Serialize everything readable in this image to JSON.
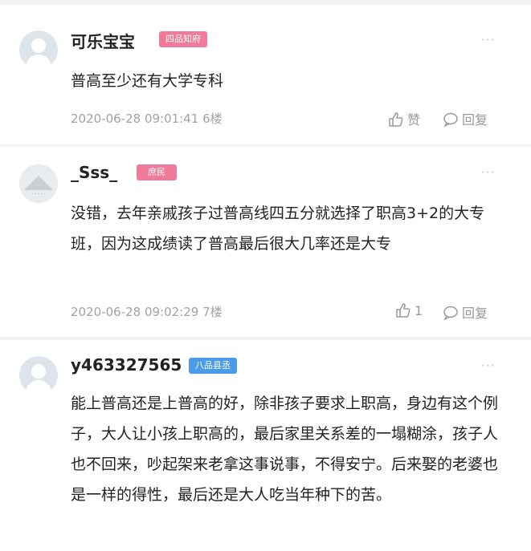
{
  "comments": [
    {
      "username": "可乐宝宝",
      "badge": "四品知府",
      "badge_color": "#f07a9a",
      "text": "普高至少还有大学专科",
      "timestamp": "2020-06-28 09:01:41",
      "floor": "6楼",
      "like_label": "赞",
      "reply_label": "回复",
      "avatar_icon": "default-user-icon"
    },
    {
      "username": "_Sss_",
      "badge": "庶民",
      "badge_color": "#f07a9a",
      "text": "没错，去年亲戚孩子过普高线四五分就选择了职高3+2的大专班，因为这成绩读了普高最后很大几率还是大专",
      "timestamp": "2020-06-28 09:02:29",
      "floor": "7楼",
      "like_count": "1",
      "reply_label": "回复",
      "avatar_icon": "landscape-avatar-icon"
    },
    {
      "username": "y463327565",
      "badge": "八品县丞",
      "badge_color": "#4a9be8",
      "text": "能上普高还是上普高的好，除非孩子要求上职高，身边有这个例子，大人让小孩上职高的，最后家里关系差的一塌糊涂，孩子人也不回来，吵起架来老拿这事说事，不得安宁。后来娶的老婆也是一样的得性，最后还是大人吃当年种下的苦。",
      "avatar_icon": "default-user-icon"
    }
  ],
  "more_icon": "more-dots-icon"
}
